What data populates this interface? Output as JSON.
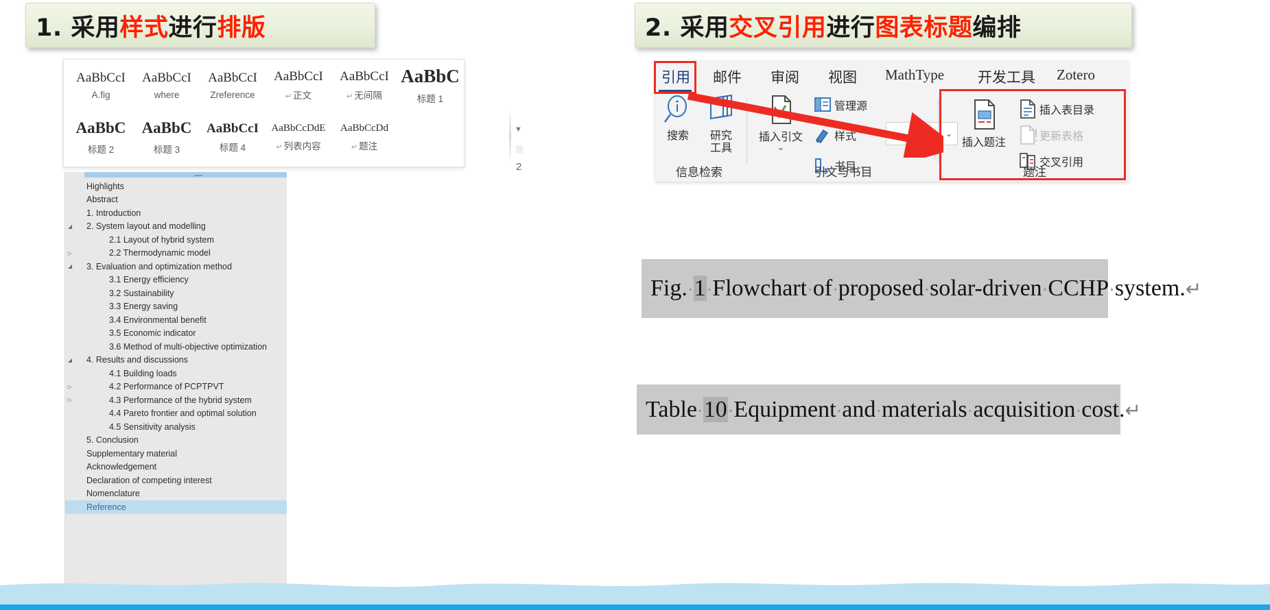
{
  "slide": {
    "section_1": {
      "number": "1.",
      "parts": [
        {
          "t": "采用",
          "c": "blk"
        },
        {
          "t": "样式",
          "c": "red"
        },
        {
          "t": "进行",
          "c": "blk"
        },
        {
          "t": "排版",
          "c": "red"
        }
      ],
      "full_text": "1. 采用样式进行排版"
    },
    "section_2": {
      "number": "2.",
      "parts": [
        {
          "t": "采用",
          "c": "blk"
        },
        {
          "t": "交叉引用",
          "c": "red"
        },
        {
          "t": "进行",
          "c": "blk"
        },
        {
          "t": "图表标题",
          "c": "red"
        },
        {
          "t": "编排",
          "c": "blk"
        }
      ],
      "full_text": "2. 采用交叉引用进行图表标题编排"
    }
  },
  "styles_gallery": {
    "row1": [
      {
        "sample": "AaBbCcI",
        "name": "A.fig",
        "pilcrow": false,
        "size": "s-nm"
      },
      {
        "sample": "AaBbCcI",
        "name": "where",
        "pilcrow": false,
        "size": "s-nm"
      },
      {
        "sample": "AaBbCcI",
        "name": "Zreference",
        "pilcrow": false,
        "size": "s-nm"
      },
      {
        "sample": "AaBbCcI",
        "name": "正文",
        "pilcrow": true,
        "size": "s-nm"
      },
      {
        "sample": "AaBbCcI",
        "name": "无间隔",
        "pilcrow": true,
        "size": "s-nm"
      },
      {
        "sample": "AaBbC",
        "name": "标题 1",
        "pilcrow": false,
        "size": "s-xl"
      }
    ],
    "row2": [
      {
        "sample": "AaBbC",
        "name": "标题 2",
        "pilcrow": false,
        "size": "s-lg"
      },
      {
        "sample": "AaBbC",
        "name": "标题 3",
        "pilcrow": false,
        "size": "s-lg"
      },
      {
        "sample": "AaBbCcI",
        "name": "标题 4",
        "pilcrow": false,
        "size": "s-md"
      },
      {
        "sample": "AaBbCcDdE",
        "name": "列表内容",
        "pilcrow": true,
        "size": "s-sm"
      },
      {
        "sample": "AaBbCcDd",
        "name": "题注",
        "pilcrow": true,
        "size": "s-sm"
      }
    ],
    "edge_artifact_number": "2",
    "edge_artifact_glyph": "▼"
  },
  "navigation_pane": {
    "minimize_glyph": "—",
    "items": [
      {
        "label": "Highlights",
        "level": 0,
        "tri": "",
        "selected": false
      },
      {
        "label": "Abstract",
        "level": 0,
        "tri": "",
        "selected": false
      },
      {
        "label": "1. Introduction",
        "level": 0,
        "tri": "",
        "selected": false
      },
      {
        "label": "2. System layout and modelling",
        "level": 0,
        "tri": "◢",
        "selected": false
      },
      {
        "label": "2.1 Layout of hybrid system",
        "level": 1,
        "tri": "",
        "selected": false
      },
      {
        "label": "2.2 Thermodynamic model",
        "level": 1,
        "tri": "▷",
        "selected": false
      },
      {
        "label": "3. Evaluation and optimization method",
        "level": 0,
        "tri": "◢",
        "selected": false
      },
      {
        "label": "3.1 Energy efficiency",
        "level": 1,
        "tri": "",
        "selected": false
      },
      {
        "label": "3.2 Sustainability",
        "level": 1,
        "tri": "",
        "selected": false
      },
      {
        "label": "3.3 Energy saving",
        "level": 1,
        "tri": "",
        "selected": false
      },
      {
        "label": "3.4 Environmental benefit",
        "level": 1,
        "tri": "",
        "selected": false
      },
      {
        "label": "3.5 Economic indicator",
        "level": 1,
        "tri": "",
        "selected": false
      },
      {
        "label": "3.6 Method of multi-objective optimization",
        "level": 1,
        "tri": "",
        "selected": false
      },
      {
        "label": "4. Results and discussions",
        "level": 0,
        "tri": "◢",
        "selected": false
      },
      {
        "label": "4.1 Building loads",
        "level": 1,
        "tri": "",
        "selected": false
      },
      {
        "label": "4.2 Performance of PCPTPVT",
        "level": 1,
        "tri": "▷",
        "selected": false
      },
      {
        "label": "4.3 Performance of the hybrid system",
        "level": 1,
        "tri": "▷",
        "selected": false
      },
      {
        "label": "4.4 Pareto frontier and optimal solution",
        "level": 1,
        "tri": "",
        "selected": false
      },
      {
        "label": "4.5 Sensitivity analysis",
        "level": 1,
        "tri": "",
        "selected": false
      },
      {
        "label": "5. Conclusion",
        "level": 0,
        "tri": "",
        "selected": false
      },
      {
        "label": "Supplementary material",
        "level": 0,
        "tri": "",
        "selected": false
      },
      {
        "label": "Acknowledgement",
        "level": 0,
        "tri": "",
        "selected": false
      },
      {
        "label": "Declaration of competing interest",
        "level": 0,
        "tri": "",
        "selected": false
      },
      {
        "label": "Nomenclature",
        "level": 0,
        "tri": "",
        "selected": false
      },
      {
        "label": "Reference",
        "level": 0,
        "tri": "",
        "selected": true
      }
    ]
  },
  "ribbon": {
    "tabs": [
      {
        "label": "引用",
        "active": true
      },
      {
        "label": "邮件",
        "active": false
      },
      {
        "label": "审阅",
        "active": false
      },
      {
        "label": "视图",
        "active": false
      },
      {
        "label": "MathType",
        "active": false
      },
      {
        "label": "开发工具",
        "active": false
      },
      {
        "label": "Zotero",
        "active": false
      }
    ],
    "groups": [
      {
        "label": "信息检索",
        "buttons": [
          {
            "name": "搜索",
            "icon": "search-info-icon"
          },
          {
            "name": "研究\n工具",
            "line1": "研究",
            "line2": "工具",
            "icon": "research-tools-icon"
          }
        ]
      },
      {
        "label": "引文与书目",
        "buttons": [
          {
            "name": "插入引文",
            "icon": "insert-citation-icon",
            "caret": "⌄"
          },
          {
            "name": "管理源",
            "icon": "manage-sources-icon"
          },
          {
            "name": "样式",
            "icon": "style-icon"
          },
          {
            "name": "书目",
            "icon": "bibliography-icon",
            "caret": "⌄"
          }
        ],
        "style_combo_value": ""
      },
      {
        "label": "题注",
        "highlighted": true,
        "buttons": [
          {
            "name": "插入题注",
            "icon": "insert-caption-icon",
            "disabled": false
          },
          {
            "name": "插入表目录",
            "icon": "insert-table-of-figures-icon",
            "disabled": false
          },
          {
            "name": "更新表格",
            "icon": "update-table-icon",
            "disabled": true
          },
          {
            "name": "交叉引用",
            "icon": "cross-reference-icon",
            "disabled": false
          }
        ]
      }
    ]
  },
  "captions": {
    "figure": {
      "prefix": "Fig.",
      "field_number": "1",
      "body": "Flowchart of proposed solar-driven CCHP system.",
      "pilcrow": "↵",
      "full_text": "Fig. 1 Flowchart of proposed solar-driven CCHP system."
    },
    "table": {
      "prefix": "Table",
      "field_number": "10",
      "body": "Equipment and materials acquisition cost.",
      "pilcrow": "↵",
      "full_text": "Table 10 Equipment and materials acquisition cost."
    }
  },
  "colors": {
    "accent_red": "#ee2b22",
    "banner_bg": "#e9f0dc",
    "wave_blue": "#bfe2f2",
    "strip_blue": "#17a9e8",
    "nav_selected": "#bcdcf0",
    "caption_bg": "#c9c9c9"
  }
}
